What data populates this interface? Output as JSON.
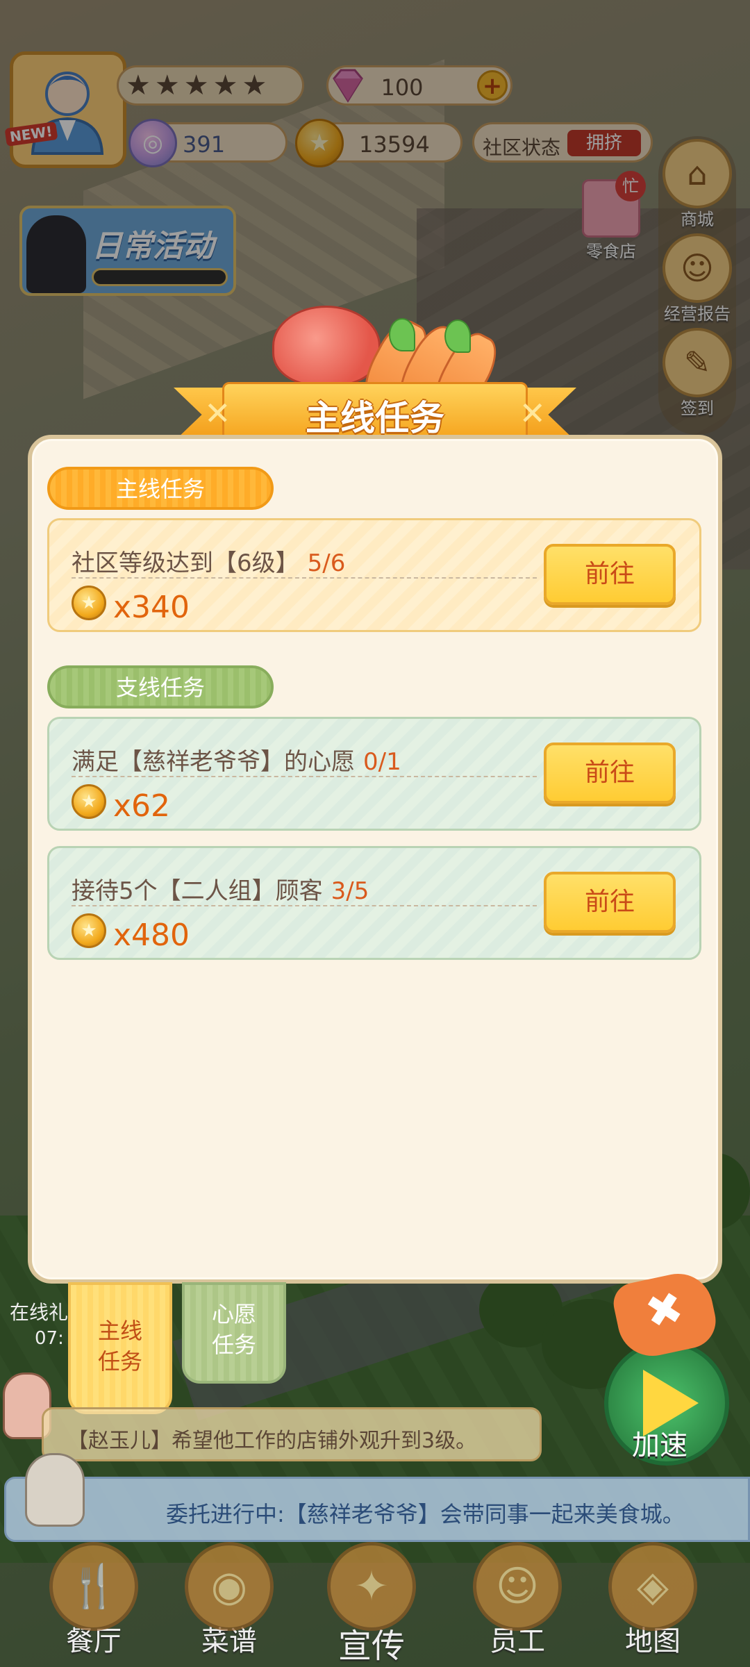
{
  "hud": {
    "new_tag": "NEW!",
    "gems": "100",
    "plus_icon": "+",
    "social_points": "391",
    "gold_coins": "13594",
    "community_label": "社区状态",
    "community_status": "拥挤",
    "daily_activity": "日常活动",
    "shop_label": "商城",
    "report_label": "经营报告",
    "checkin_label": "签到",
    "snack_label": "零食店",
    "snack_busy": "忙"
  },
  "dialog": {
    "title": "主线任务",
    "main_section": "主线任务",
    "side_section": "支线任务",
    "tasks_main": [
      {
        "text": "社区等级达到【6级】",
        "progress": "5/6",
        "reward": "x340",
        "button": "前往"
      }
    ],
    "tasks_side": [
      {
        "text": "满足【慈祥老爷爷】的心愿",
        "progress": "0/1",
        "reward": "x62",
        "button": "前往"
      },
      {
        "text": "接待5个【二人组】顾客",
        "progress": "3/5",
        "reward": "x480",
        "button": "前往"
      }
    ],
    "tab_main_line1": "主线",
    "tab_main_line2": "任务",
    "tab_wish_line1": "心愿",
    "tab_wish_line2": "任务",
    "close_icon": "✖"
  },
  "lower": {
    "online": "在线礼",
    "online_time": "07:",
    "speedup": "加速",
    "notice": "【赵玉儿】希望他工作的店铺外观升到3级。",
    "entrust": "委托进行中:【慈祥老爷爷】会带同事一起来美食城。"
  },
  "nav": [
    {
      "label": "餐厅"
    },
    {
      "label": "菜谱"
    },
    {
      "label": "宣传"
    },
    {
      "label": "员工"
    },
    {
      "label": "地图"
    }
  ],
  "colors": {
    "accent_orange": "#ffc74a",
    "reward_text": "#e1640c",
    "progress_text": "#d95a1d",
    "button_yellow": "#ffd34d"
  }
}
